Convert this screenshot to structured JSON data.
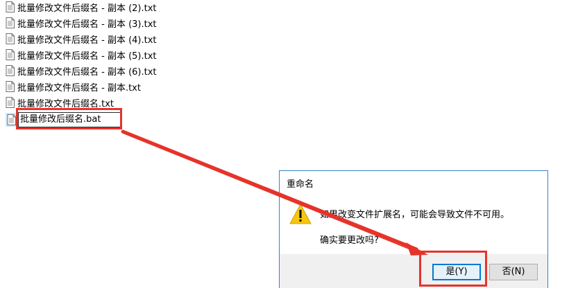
{
  "files": [
    {
      "name": "批量修改文件后缀名 - 副本 (2).txt"
    },
    {
      "name": "批量修改文件后缀名 - 副本 (3).txt"
    },
    {
      "name": "批量修改文件后缀名 - 副本 (4).txt"
    },
    {
      "name": "批量修改文件后缀名 - 副本 (5).txt"
    },
    {
      "name": "批量修改文件后缀名 - 副本 (6).txt"
    },
    {
      "name": "批量修改文件后缀名 - 副本.txt"
    },
    {
      "name": "批量修改文件后缀名.txt"
    }
  ],
  "rename": {
    "value": "批量修改后缀名.bat"
  },
  "dialog": {
    "title": "重命名",
    "message1": "如果改变文件扩展名，可能会导致文件不可用。",
    "message2": "确实要更改吗?",
    "yes_label": "是(Y)",
    "no_label": "否(N)"
  },
  "colors": {
    "highlight": "#e6332a",
    "dialog_border": "#3b7fc4",
    "primary_button_border": "#0078d7"
  }
}
